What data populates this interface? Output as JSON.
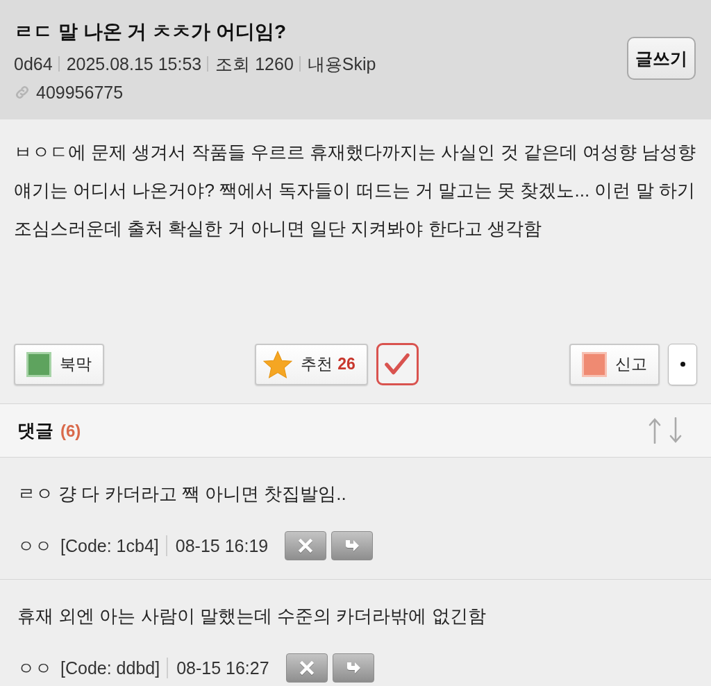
{
  "post": {
    "title": "ㄹㄷ 말 나온 거 ㅊㅊ가 어디임?",
    "meta": [
      "0d64",
      "2025.08.15 15:53",
      "조회 1260",
      "내용Skip"
    ],
    "link": "409956775",
    "write_button": "글쓰기",
    "body": "ㅂㅇㄷ에 문제 생겨서 작품들 우르르 휴재했다까지는 사실인 것 같은데 여성향 남성향 얘기는 어디서 나온거야? 짹에서 독자들이 떠드는 거 말고는 못 찾겠노... 이런 말 하기 조심스러운데 출처 확실한 거 아니면 일단 지켜봐야 한다고 생각함"
  },
  "actions": {
    "left": [
      {
        "kind": "bookmark",
        "label": "북막"
      }
    ],
    "center": [
      {
        "kind": "recommend",
        "label": "추천",
        "count": "26"
      },
      {
        "kind": "check"
      }
    ],
    "right": [
      {
        "kind": "report",
        "label": "신고"
      },
      {
        "kind": "more"
      }
    ]
  },
  "comments": {
    "title": "댓글",
    "count": "(6)",
    "items": [
      {
        "text": "ㄹㅇ 걍 다 카더라고 짹 아니면 찻집발임..",
        "author": "ㅇㅇ",
        "code": "[Code: 1cb4]",
        "time": "08-15 16:19"
      },
      {
        "text": "휴재 외엔 아는 사람이 말했는데 수준의 카더라밖에 없긴함",
        "author": "ㅇㅇ",
        "code": "[Code: ddbd]",
        "time": "08-15 16:27"
      }
    ]
  }
}
